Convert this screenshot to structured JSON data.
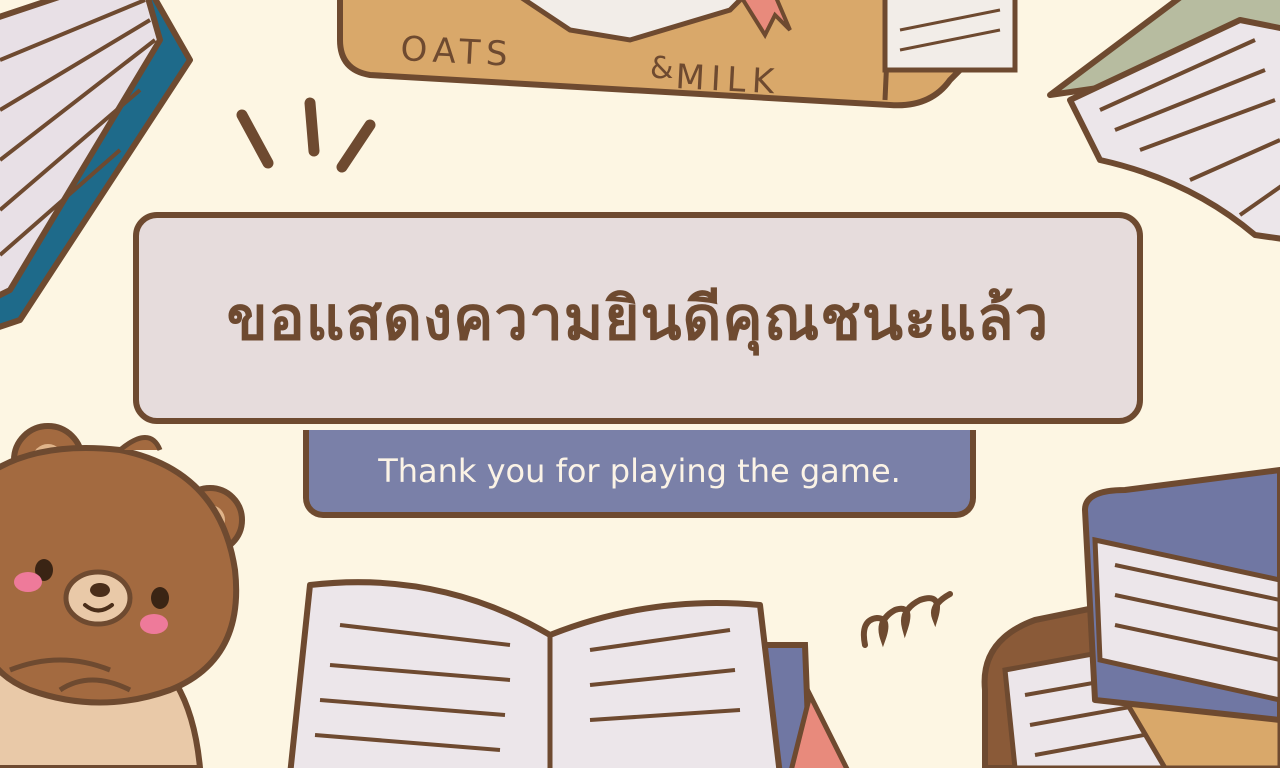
{
  "screen": {
    "title": "ขอแสดงความยินดีคุณชนะแล้ว",
    "subtitle": "Thank you for playing the game."
  },
  "decor": {
    "book_label_left": "OATS",
    "book_label_right": "MILK"
  },
  "colors": {
    "background": "#fdf6e3",
    "outline": "#6e4a30",
    "title_box": "#e6dcdc",
    "subtitle_box": "#7a80a8",
    "subtitle_text": "#fbf3e6",
    "book_tan": "#d9a86a",
    "book_blue": "#1e6a8a",
    "book_navy": "#7077a3",
    "bear_brown": "#a36a40",
    "cheek_pink": "#ee7a9a"
  }
}
